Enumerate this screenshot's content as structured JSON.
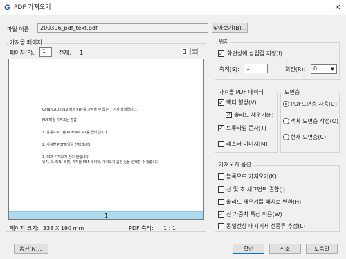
{
  "window": {
    "title": "PDF 가져오기",
    "logo": "G"
  },
  "file": {
    "label": "파일 이름:",
    "value": "200306_pdf_text.pdf",
    "browse_button": "찾아보기(B)..."
  },
  "import_page": {
    "group_title": "가져올 페이지",
    "page_label": "페이지(P):",
    "page_value": "1",
    "total_label": "전체:",
    "total_value": "1",
    "page_indicator": "1",
    "preview_lines": [
      "GstarCAD2019 에서 PDF를 가져올 수 없는 7 가지 상황입니다.",
      "PDF파일 가져오는 방법",
      "1. 응용프로그램 PDFIMPORT를 입력합니다.",
      "2. 사용할 PDF파일을 선택합니다.",
      "3. PDF 가져오기 창이 열립니다.",
      "위치, 쪽 축척, 회전, 가져올 PDF 데이터, 가져오기 옵션 등을 선택할 수 있습니다"
    ],
    "page_size_label": "페이지 크기:",
    "page_size_value": "338 X 190 mm",
    "pdf_scale_label": "PDF 축적:",
    "pdf_scale_value": "1 : 1"
  },
  "position": {
    "group_title": "위치",
    "specify_on_screen": {
      "label": "화면상에 삽입점 지정(I)",
      "checked": true
    },
    "scale_label": "축척(S):",
    "scale_value": "1",
    "rotation_label": "회전(R):",
    "rotation_value": "0"
  },
  "pdf_data": {
    "group_title": "가져올 PDF 데이터",
    "vector_geometry": {
      "label": "벡터 형상(V)",
      "checked": true
    },
    "solid_fill": {
      "label": "솔리드 채우기(F)",
      "checked": true
    },
    "truetype_text": {
      "label": "트루타입 문자(T)",
      "checked": true
    },
    "raster_image": {
      "label": "래스터 이미지(M)",
      "checked": false
    }
  },
  "layers": {
    "group_title": "도면층",
    "use_pdf_layers": {
      "label": "PDF도면층 사용(U)",
      "selected": true
    },
    "create_object_layers": {
      "label": "객체 도면층 작성(O)",
      "selected": false
    },
    "current_layer": {
      "label": "현재 도면층(C)",
      "selected": false
    }
  },
  "import_options": {
    "group_title": "가져오기 옵션",
    "import_as_block": {
      "label": "블록으로 가져오기(K)",
      "checked": false
    },
    "join_segments": {
      "label": "선 및 호 세그먼트 결합(J)",
      "checked": false
    },
    "solid_fill_to_hatch": {
      "label": "솔리드 채우기를 해치로 변환(H)",
      "checked": false
    },
    "apply_lineweight": {
      "label": "선 가중치 특성 적용(W)",
      "checked": true
    },
    "infer_linetypes": {
      "label": "동일선상 대시에서 선종류 추정(L)",
      "checked": false
    }
  },
  "footer": {
    "options_button": "옵션(N)...",
    "ok_button": "확인",
    "cancel_button": "취소",
    "help_button": "도움말"
  },
  "icons": {
    "close": "close-icon",
    "single_view": "single-page-view-icon",
    "grid_view": "grid-view-icon"
  }
}
